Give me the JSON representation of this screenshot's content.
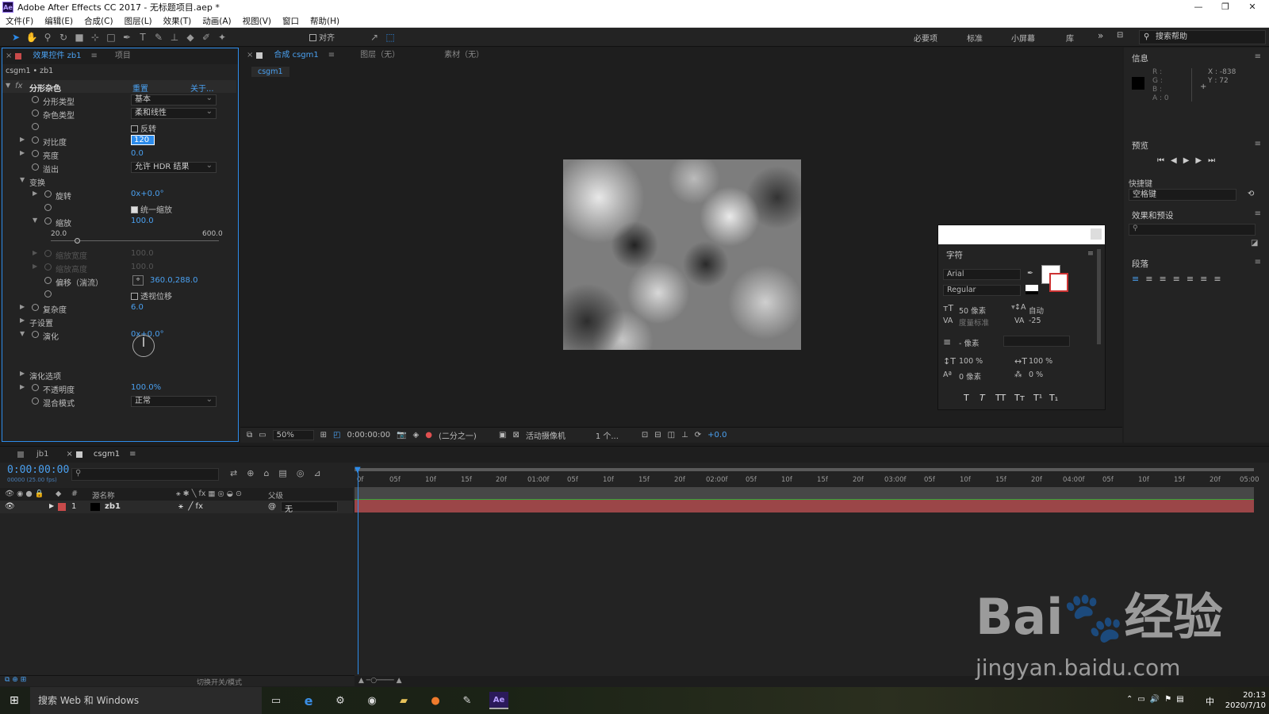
{
  "title": "Adobe After Effects CC 2017 - 无标题项目.aep *",
  "menu": [
    "文件(F)",
    "编辑(E)",
    "合成(C)",
    "图层(L)",
    "效果(T)",
    "动画(A)",
    "视图(V)",
    "窗口",
    "帮助(H)"
  ],
  "toolbar": {
    "snap_label": "对齐"
  },
  "workspaces": [
    "必要项",
    "标准",
    "小屏幕",
    "库"
  ],
  "help_search": "搜索帮助",
  "effects_panel": {
    "tab": "效果控件 zb1",
    "tab2": "项目",
    "breadcrumb": "csgm1 • zb1",
    "effect_name": "分形杂色",
    "reset": "重置",
    "about": "关于...",
    "fractal_type_label": "分形类型",
    "fractal_type": "基本",
    "noise_type_label": "杂色类型",
    "noise_type": "柔和线性",
    "invert_label": "反转",
    "contrast_label": "对比度",
    "contrast": "120",
    "brightness_label": "亮度",
    "brightness": "0.0",
    "overflow_label": "溢出",
    "overflow": "允许 HDR 结果",
    "transform_label": "变换",
    "rotation_label": "旋转",
    "rotation": "0x+0.0°",
    "uniform_scale_label": "统一缩放",
    "scale_label": "缩放",
    "scale": "100.0",
    "slider_min": "20.0",
    "slider_max": "600.0",
    "scale_width_label": "缩放宽度",
    "scale_width": "100.0",
    "scale_height_label": "缩放高度",
    "scale_height": "100.0",
    "offset_label": "偏移（湍流）",
    "offset": "360.0,288.0",
    "perspective_label": "透视位移",
    "complexity_label": "复杂度",
    "complexity": "6.0",
    "sub_label": "子设置",
    "evolution_label": "演化",
    "evolution": "0x+0.0°",
    "evolution_opts_label": "演化选项",
    "opacity_label": "不透明度",
    "opacity": "100.0%",
    "blend_label": "混合模式",
    "blend": "正常"
  },
  "comp_panel": {
    "tab": "合成 csgm1",
    "layer_tab": "图层（无）",
    "footage_tab": "素材（无）",
    "comp_chip": "csgm1",
    "zoom": "50%",
    "time": "0:00:00:00",
    "resolution": "(二分之一)",
    "camera": "活动摄像机",
    "views": "1 个...",
    "exposure": "+0.0"
  },
  "character_panel": {
    "title": "字符",
    "font": "Arial",
    "style": "Regular",
    "size": "50 像素",
    "leading": "自动",
    "kerning": "度量标准",
    "tracking": "-25",
    "stroke": "- 像素",
    "vscale": "100 %",
    "hscale": "100 %",
    "baseline": "0 像素",
    "tsume": "0 %",
    "styles": [
      "T",
      "T",
      "TT",
      "Tт",
      "T¹",
      "T₁"
    ]
  },
  "info_panel": {
    "title": "信息",
    "r": "R :",
    "g": "G :",
    "b": "B :",
    "a": "A : 0",
    "x": "X : -838",
    "y": "Y : 72"
  },
  "preview_panel": {
    "title": "预览",
    "shortcut_label": "快捷键",
    "shortcut": "空格键"
  },
  "effects_presets": {
    "title": "效果和预设"
  },
  "paragraph": {
    "title": "段落"
  },
  "timeline": {
    "tab1": "jb1",
    "tab2": "csgm1",
    "timecode": "0:00:00:00",
    "fps": "00000 (25.00 fps)",
    "col_source": "源名称",
    "col_parent": "父级",
    "layer_num": "1",
    "layer_name": "zb1",
    "parent": "无",
    "ruler": [
      "0f",
      "05f",
      "10f",
      "15f",
      "20f",
      "01:00f",
      "05f",
      "10f",
      "15f",
      "20f",
      "02:00f",
      "05f",
      "10f",
      "15f",
      "20f",
      "03:00f",
      "05f",
      "10f",
      "15f",
      "20f",
      "04:00f",
      "05f",
      "10f",
      "15f",
      "20f",
      "05:00"
    ],
    "toggle_label": "切换开关/模式"
  },
  "taskbar": {
    "search": "搜索 Web 和 Windows",
    "time": "20:13",
    "date": "2020/7/10",
    "ime": "中"
  },
  "watermark": {
    "logo": "Bai🐾经验",
    "url": "jingyan.baidu.com"
  }
}
